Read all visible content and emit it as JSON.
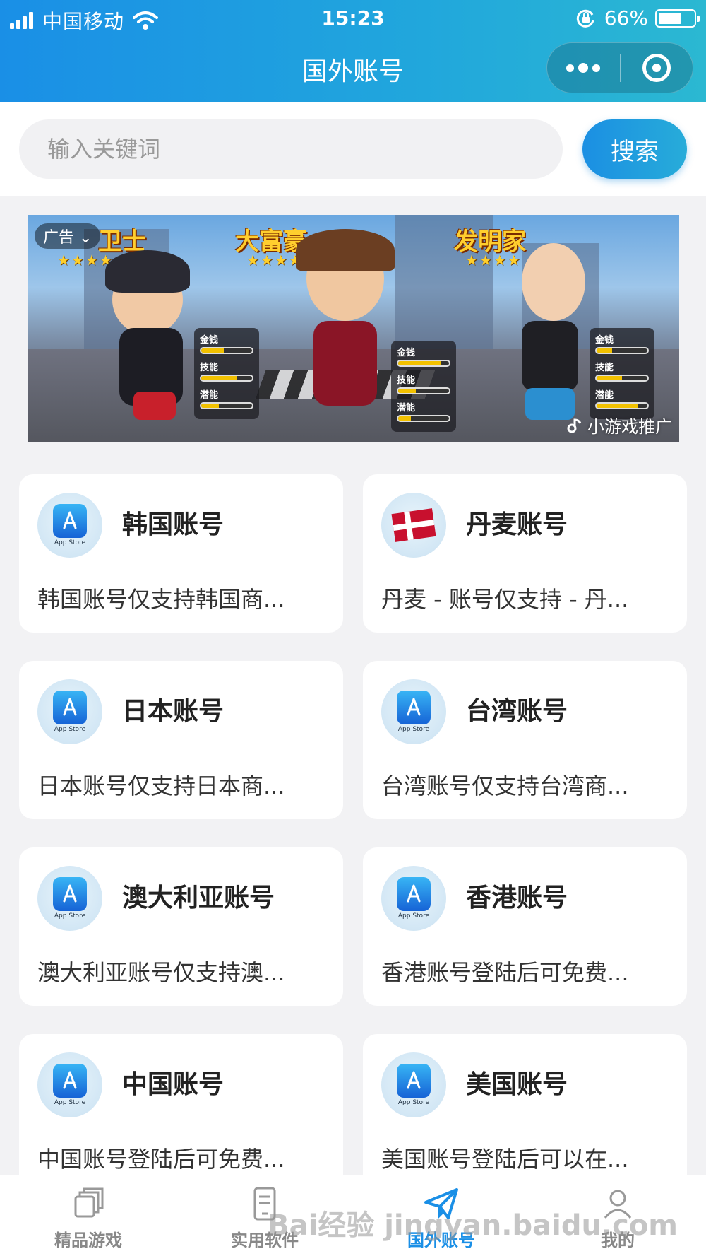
{
  "status_bar": {
    "carrier": "中国移动",
    "time": "15:23",
    "battery": "66%"
  },
  "nav": {
    "title": "国外账号"
  },
  "search": {
    "placeholder": "输入关键词",
    "button_label": "搜索"
  },
  "banner": {
    "ad_label": "广告",
    "chevron": "⌄",
    "characters": [
      "卫士",
      "大富豪",
      "发明家"
    ],
    "stats": [
      "金钱",
      "技能",
      "潜能"
    ],
    "promo_label": "小游戏推广"
  },
  "accounts": [
    {
      "title": "韩国账号",
      "desc": "韩国账号仅支持韩国商...",
      "icon": "app-store-icon"
    },
    {
      "title": "丹麦账号",
      "desc": "丹麦 - 账号仅支持 - 丹...",
      "icon": "denmark-flag-icon"
    },
    {
      "title": "日本账号",
      "desc": "日本账号仅支持日本商...",
      "icon": "app-store-icon"
    },
    {
      "title": "台湾账号",
      "desc": "台湾账号仅支持台湾商...",
      "icon": "app-store-icon"
    },
    {
      "title": "澳大利亚账号",
      "desc": "澳大利亚账号仅支持澳...",
      "icon": "app-store-icon"
    },
    {
      "title": "香港账号",
      "desc": "香港账号登陆后可免费...",
      "icon": "app-store-icon"
    },
    {
      "title": "中国账号",
      "desc": "中国账号登陆后可免费...",
      "icon": "app-store-icon"
    },
    {
      "title": "美国账号",
      "desc": "美国账号登陆后可以在...",
      "icon": "app-store-icon"
    }
  ],
  "app_store_label": "App Store",
  "tabs": [
    {
      "label": "精品游戏",
      "icon": "games-icon",
      "active": false
    },
    {
      "label": "实用软件",
      "icon": "software-icon",
      "active": false
    },
    {
      "label": "国外账号",
      "icon": "paper-plane-icon",
      "active": true
    },
    {
      "label": "我的",
      "icon": "profile-icon",
      "active": false
    }
  ],
  "watermark": "Bai经验 jingyan.baidu.com",
  "colors": {
    "accent": "#1a8fe6",
    "header_end": "#2bb8d2",
    "background": "#f2f2f4"
  }
}
